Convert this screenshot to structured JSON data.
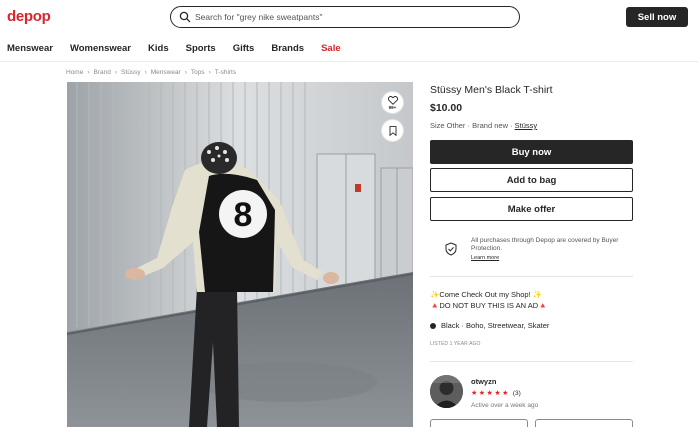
{
  "header": {
    "logo": "depop",
    "search_placeholder": "Search for \"grey nike sweatpants\"",
    "sell_label": "Sell now"
  },
  "nav": {
    "items": [
      "Menswear",
      "Womenswear",
      "Kids",
      "Sports",
      "Gifts",
      "Brands",
      "Sale"
    ]
  },
  "breadcrumb": [
    "Home",
    "Brand",
    "Stüssy",
    "Menswear",
    "Tops",
    "T-shirts"
  ],
  "product": {
    "like_count": "99+",
    "title": "Stüssy Men's Black T-shirt",
    "price": "$10.00",
    "size": "Size Other",
    "condition": "Brand new",
    "brand": "Stüssy",
    "buy_label": "Buy now",
    "bag_label": "Add to bag",
    "offer_label": "Make offer"
  },
  "protection": {
    "text": "All purchases through Depop are covered by Buyer Protection.",
    "learn_more": "Learn more"
  },
  "description": {
    "line1": "✨Come Check Out my Shop! ✨",
    "line2": "🔺DO NOT BUY THIS IS AN AD🔺"
  },
  "attributes": {
    "color": "Black",
    "styles": "Boho, Streetwear, Skater"
  },
  "listed": "LISTED 1 YEAR AGO",
  "seller": {
    "username": "otwyzn",
    "stars": "★★★★★",
    "review_count": "(3)",
    "active": "Active over a week ago"
  },
  "colors": {
    "brand_red": "#d9252c",
    "dark": "#262626"
  }
}
